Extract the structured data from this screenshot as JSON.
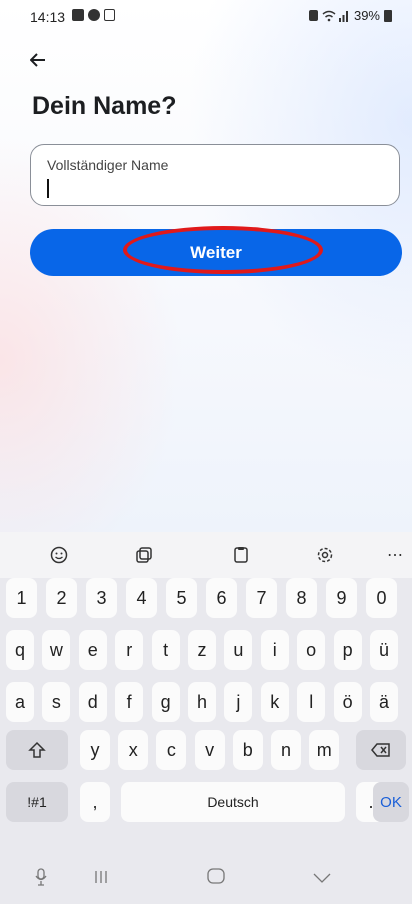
{
  "status_bar": {
    "time": "14:13",
    "battery": "39%"
  },
  "page": {
    "title": "Dein Name?",
    "back_icon": "arrow-left-icon"
  },
  "name_field": {
    "label": "Vollständiger Name",
    "value": ""
  },
  "next_button": {
    "label": "Weiter",
    "color": "#0866e8",
    "highlight_color": "#e0191a"
  },
  "keyboard_toolbar": [
    "emoji-icon",
    "sticker-icon",
    "clipboard-icon",
    "settings-icon",
    "more-icon"
  ],
  "keyboard": {
    "row_numbers": [
      "1",
      "2",
      "3",
      "4",
      "5",
      "6",
      "7",
      "8",
      "9",
      "0"
    ],
    "row_1": [
      "q",
      "w",
      "e",
      "r",
      "t",
      "z",
      "u",
      "i",
      "o",
      "p",
      "ü"
    ],
    "row_2": [
      "a",
      "s",
      "d",
      "f",
      "g",
      "h",
      "j",
      "k",
      "l",
      "ö",
      "ä"
    ],
    "row_3": [
      "y",
      "x",
      "c",
      "v",
      "b",
      "n",
      "m"
    ],
    "symbols_label": "!#1",
    "comma_label": ",",
    "space_label": "Deutsch",
    "period_label": ".",
    "ok_label": "OK"
  }
}
